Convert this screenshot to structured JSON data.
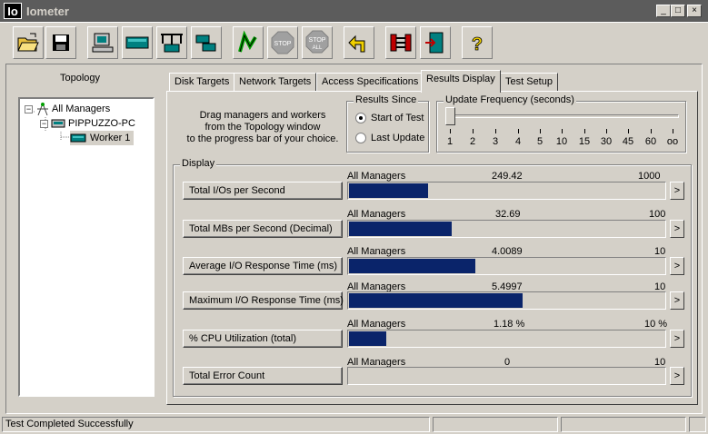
{
  "window": {
    "icon_text": "Io",
    "title": "Iometer",
    "minimize": "_",
    "maximize": "□",
    "close": "×"
  },
  "toolbar": {
    "buttons": [
      {
        "icon": "open-folder-icon"
      },
      {
        "icon": "save-disk-icon"
      },
      {
        "icon": "computer-icon"
      },
      {
        "icon": "worker-disk-icon"
      },
      {
        "icon": "worker-network-icon"
      },
      {
        "icon": "duplicate-worker-icon"
      },
      {
        "icon": "start-flag-icon"
      },
      {
        "icon": "stop-icon",
        "label": "STOP"
      },
      {
        "icon": "stop-all-icon",
        "label": "STOP",
        "sublabel": "ALL"
      },
      {
        "icon": "reset-arrow-icon"
      },
      {
        "icon": "disconnect-icon"
      },
      {
        "icon": "exit-door-icon"
      },
      {
        "icon": "help-icon",
        "label": "?"
      }
    ]
  },
  "topology": {
    "title": "Topology",
    "root": {
      "label": "All Managers",
      "expander": "−"
    },
    "manager": {
      "label": "PIPPUZZO-PC",
      "expander": "−"
    },
    "worker": {
      "label": "Worker 1"
    }
  },
  "tabs": [
    {
      "label": "Disk Targets"
    },
    {
      "label": "Network Targets"
    },
    {
      "label": "Access Specifications"
    },
    {
      "label": "Results Display",
      "active": true
    },
    {
      "label": "Test Setup"
    }
  ],
  "results": {
    "instructions": [
      "Drag managers and workers",
      "from the Topology window",
      "to the progress bar of your choice."
    ],
    "since": {
      "title": "Results Since",
      "options": [
        {
          "label": "Start of Test",
          "selected": true
        },
        {
          "label": "Last Update",
          "selected": false
        }
      ]
    },
    "update_frequency": {
      "title": "Update Frequency (seconds)",
      "ticks": [
        "1",
        "2",
        "3",
        "4",
        "5",
        "10",
        "15",
        "30",
        "45",
        "60",
        "oo"
      ],
      "selected": "1"
    },
    "display": {
      "title": "Display",
      "rows": [
        {
          "metric": "Total I/Os per Second",
          "target": "All Managers",
          "value": "249.42",
          "max": "1000",
          "fraction": 0.2494
        },
        {
          "metric": "Total MBs per Second (Decimal)",
          "target": "All Managers",
          "value": "32.69",
          "max": "100",
          "fraction": 0.3269
        },
        {
          "metric": "Average I/O Response Time (ms)",
          "target": "All Managers",
          "value": "4.0089",
          "max": "10",
          "fraction": 0.4009
        },
        {
          "metric": "Maximum I/O Response Time (ms)",
          "target": "All Managers",
          "value": "5.4997",
          "max": "10",
          "fraction": 0.55
        },
        {
          "metric": "% CPU Utilization (total)",
          "target": "All Managers",
          "value": "1.18 %",
          "max": "10 %",
          "fraction": 0.118
        },
        {
          "metric": "Total Error Count",
          "target": "All Managers",
          "value": "0",
          "max": "10",
          "fraction": 0
        }
      ],
      "arrow": ">"
    }
  },
  "statusbar": {
    "text": "Test Completed Successfully"
  }
}
